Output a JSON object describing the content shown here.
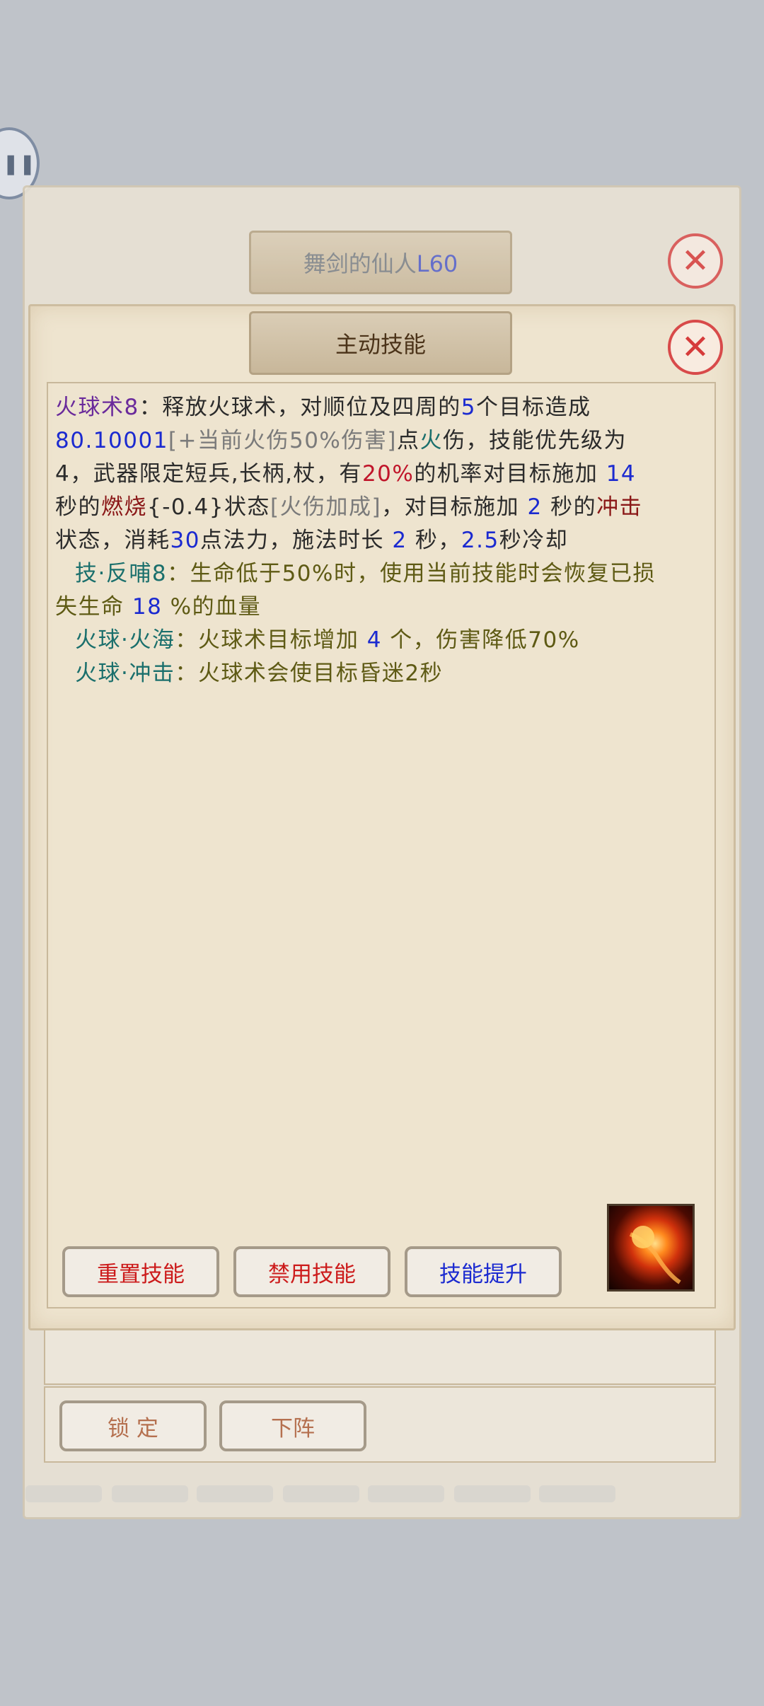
{
  "outer_panel": {
    "title": "舞剑的仙人",
    "level": "L60"
  },
  "inner_panel": {
    "title": "主动技能"
  },
  "skill_desc": {
    "l1": {
      "a": "火球术8",
      "b": "：释放火球术，对顺位及四周的",
      "c": "5",
      "d": "个目标造成"
    },
    "l2": {
      "a": "80.10001",
      "b": "[+当前火伤50%伤害]",
      "c": "点",
      "d": "火",
      "e": "伤，技能优先级为"
    },
    "l3": {
      "a": "4，武器限定短兵,长柄,杖，有",
      "b": "20%",
      "c": "的机率对目标施加 ",
      "d": "14"
    },
    "l4": {
      "a": "秒的",
      "b": "燃烧",
      "c": "{-0.4}",
      "d": "状态",
      "e": "[火伤加成]",
      "f": "，对目标施加 ",
      "g": "2",
      "h": " 秒的",
      "i": "冲击"
    },
    "l5": {
      "a": "状态，消耗",
      "b": "30",
      "c": "点法力，施法时长 ",
      "d": "2",
      "e": " 秒，",
      "f": "2.5",
      "g": "秒冷却"
    },
    "l6": {
      "a": "技·反哺8",
      "b": "：生命低于50%时，使用当前技能时会恢复已损"
    },
    "l7": {
      "a": "失生命 ",
      "b": "18",
      "c": " %的血量"
    },
    "l8": {
      "a": "火球·火海",
      "b": "：火球术目标增加 ",
      "c": "4",
      "d": " 个，伤害降低70%"
    },
    "l9": {
      "a": "火球·冲击",
      "b": "：火球术会使目标昏迷2秒"
    }
  },
  "buttons": {
    "reset": "重置技能",
    "disable": "禁用技能",
    "upgrade": "技能提升",
    "lock": "锁 定",
    "down": "下阵"
  },
  "icons": {
    "close": "close-icon",
    "skill": "fireball-skill-icon"
  },
  "colors": {
    "purple": "#6a2a9b",
    "blue": "#1b2ad0",
    "red": "#c0152a",
    "teal": "#1a6f6c"
  }
}
